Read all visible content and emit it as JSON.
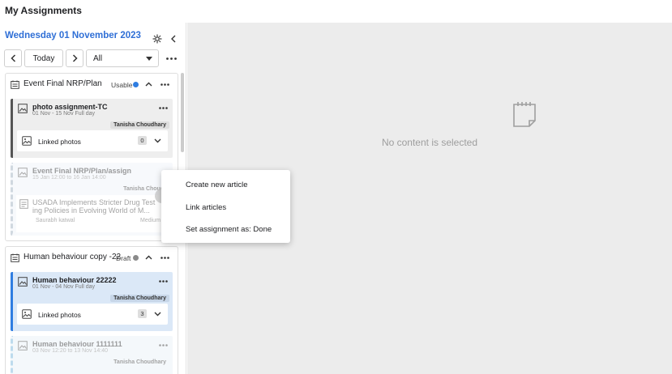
{
  "header": {
    "title": "My Assignments"
  },
  "toolbar": {
    "date": "Wednesday 01 November 2023",
    "today_label": "Today",
    "filter_value": "All"
  },
  "groups": [
    {
      "title": "Event Final NRP/Plan",
      "state": "Usable",
      "state_color": "#2f7de1",
      "cards": [
        {
          "title": "photo assignment-TC",
          "dates": "01 Nov - 15 Nov Full day",
          "user": "Tanisha Choudhary",
          "linked_label": "Linked photos",
          "linked_count": "0"
        },
        {
          "title": "Event Final NRP/Plan/assign",
          "dates": "15 Jan 12:00 to 16 Jan 14:00",
          "user": "Tanisha Choudhar"
        }
      ],
      "article": {
        "title_line1": "USADA Implements Stricter Drug Test",
        "title_line2": "ing Policies in Evolving World of M...",
        "author": "Saurabh katwal",
        "priority": "Medium"
      }
    },
    {
      "title": "Human behaviour copy -22",
      "state": "Draft",
      "state_color": "#8a8a8a",
      "cards": [
        {
          "title": "Human behaviour 22222",
          "dates": "01 Nov - 04 Nov Full day",
          "user": "Tanisha Choudhary",
          "linked_label": "Linked photos",
          "linked_count": "3"
        },
        {
          "title": "Human behaviour 1111111",
          "dates": "03 Nov 12:20 to 13 Nov 14:40",
          "user": "Tanisha Choudhary"
        }
      ]
    }
  ],
  "empty_state": {
    "text": "No content is selected"
  },
  "context_menu": {
    "items": [
      "Create new article",
      "Link articles",
      "Set assignment as: Done"
    ]
  },
  "colors": {
    "accent": "#2f6fd6",
    "card_selected": "#dbe8f7",
    "empty_bg": "#ececec"
  }
}
